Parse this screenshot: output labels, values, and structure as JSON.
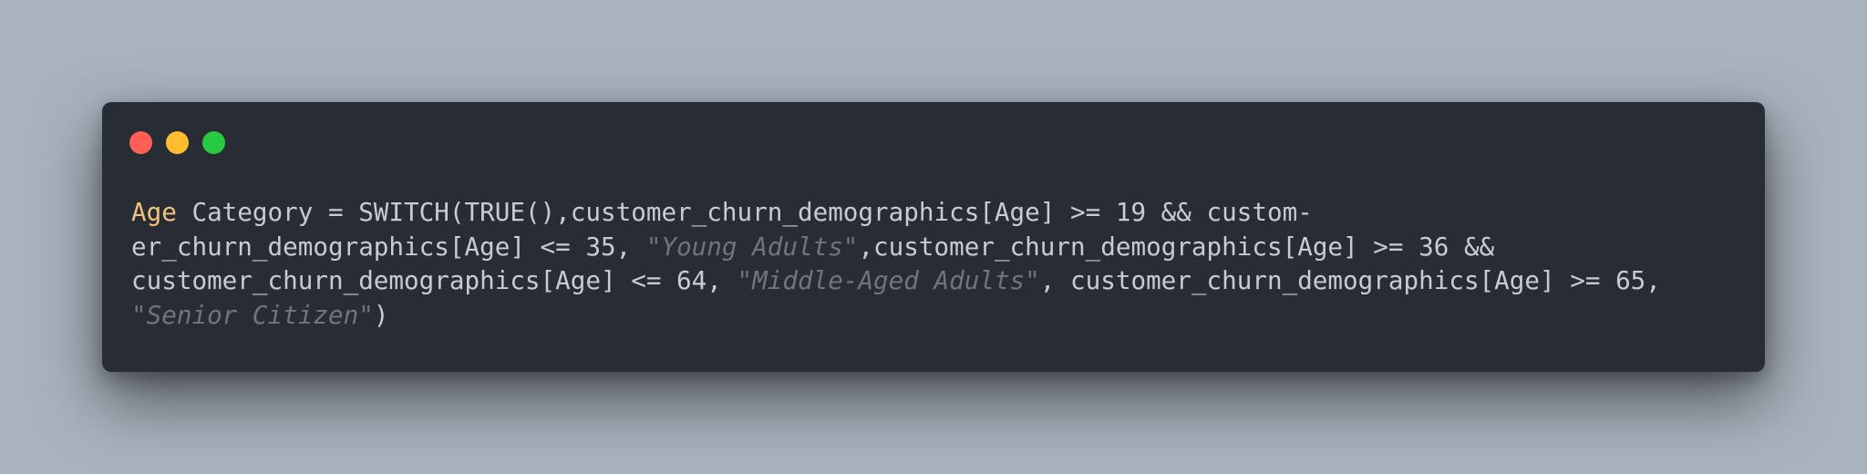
{
  "window": {
    "controls": [
      "close",
      "minimize",
      "maximize"
    ]
  },
  "code": {
    "line1": {
      "keyword": "Age",
      "text": " Category = SWITCH(TRUE(),customer_churn_demographics[Age] >= 19 && custom-"
    },
    "line2": {
      "pre": "er_churn_demographics[Age] <= 35, ",
      "string": "\"Young Adults\"",
      "post": ",customer_churn_demographics[Age] >= 36 &&"
    },
    "line3": {
      "pre": "customer_churn_demographics[Age] <= 64, ",
      "string": "\"Middle-Aged Adults\"",
      "post": ", customer_churn_demographics[Age] >= 65,"
    },
    "line4": {
      "string": "\"Senior Citizen\"",
      "post": ")"
    }
  },
  "colors": {
    "background": "#a8b3bd",
    "window": "#282c35",
    "text": "#c7cbd2",
    "keyword": "#f3c27a",
    "string": "#6e7480",
    "close": "#ff5f57",
    "minimize": "#febc2e",
    "maximize": "#28c840"
  }
}
